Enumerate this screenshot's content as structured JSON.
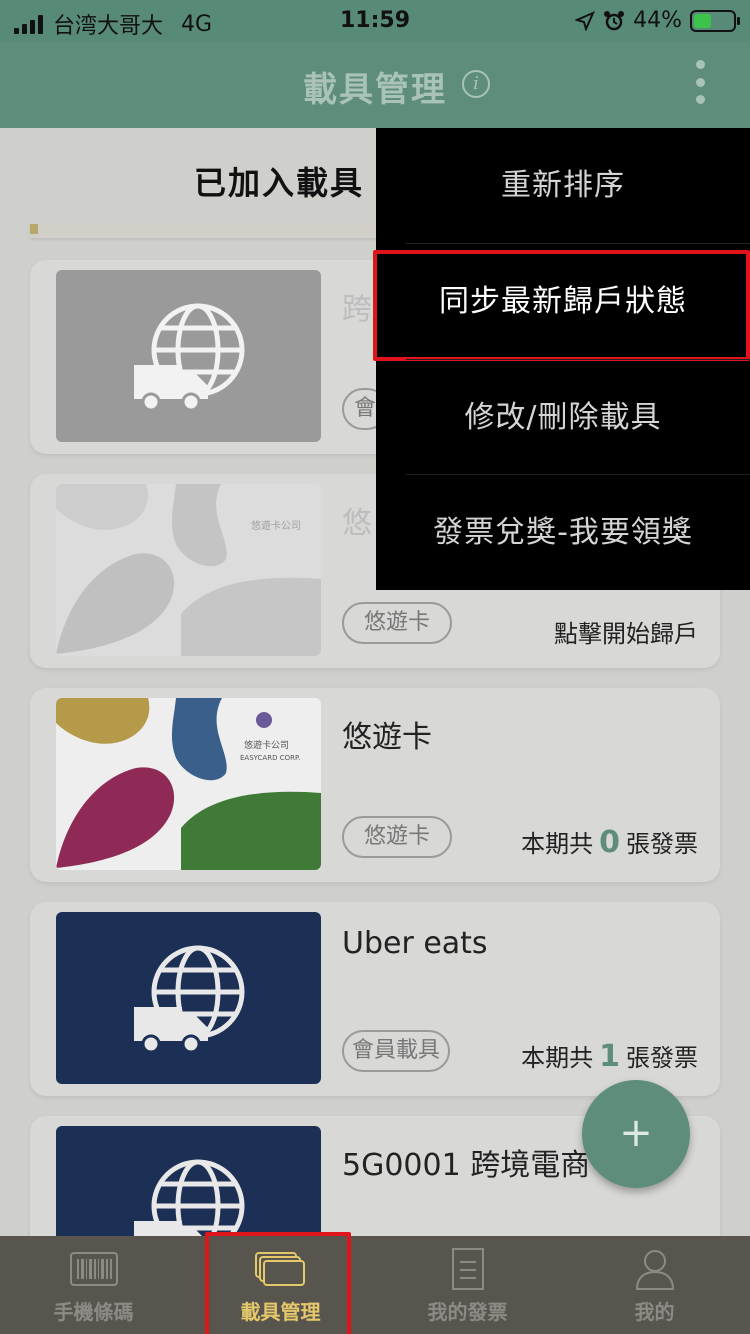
{
  "status_bar": {
    "carrier": "台湾大哥大",
    "network": "4G",
    "time": "11:59",
    "battery": "44%",
    "battery_level": 0.44
  },
  "header": {
    "title": "載具管理",
    "info_icon": "info-icon",
    "more_icon": "more-vertical-icon"
  },
  "section_title": "已加入載具",
  "cards": [
    {
      "name": "跨",
      "tag": "會",
      "count_prefix": "",
      "count": "",
      "count_suffix": "",
      "thumb": "globe-truck-icon"
    },
    {
      "name": "悠",
      "tag": "悠遊卡",
      "action": "點擊開始歸戶",
      "thumb": "easycard-faded"
    },
    {
      "name": "悠遊卡",
      "tag": "悠遊卡",
      "count_prefix": "本期共",
      "count": "0",
      "count_suffix": "張發票",
      "thumb": "easycard"
    },
    {
      "name": "Uber eats",
      "tag": "會員載具",
      "count_prefix": "本期共",
      "count": "1",
      "count_suffix": "張發票",
      "thumb": "globe-truck-icon"
    },
    {
      "name": "5G0001 跨境電商",
      "thumb": "globe-truck-icon"
    }
  ],
  "menu": {
    "items": [
      {
        "label": "重新排序"
      },
      {
        "label": "同步最新歸戶狀態",
        "highlighted": true
      },
      {
        "label": "修改/刪除載具"
      },
      {
        "label": "發票兌獎-我要領獎"
      }
    ]
  },
  "fab": {
    "label": "+"
  },
  "tabs": [
    {
      "label": "手機條碼",
      "icon": "barcode-icon",
      "active": false
    },
    {
      "label": "載具管理",
      "icon": "cards-icon",
      "active": true
    },
    {
      "label": "我的發票",
      "icon": "receipt-icon",
      "active": false
    },
    {
      "label": "我的",
      "icon": "person-icon",
      "active": false
    }
  ],
  "colors": {
    "header": "#5f8d7b",
    "accent": "#5f8d7b",
    "tab_active": "#e4c86a",
    "highlight_border": "#e0141b",
    "navy_card": "#1c2f55"
  }
}
